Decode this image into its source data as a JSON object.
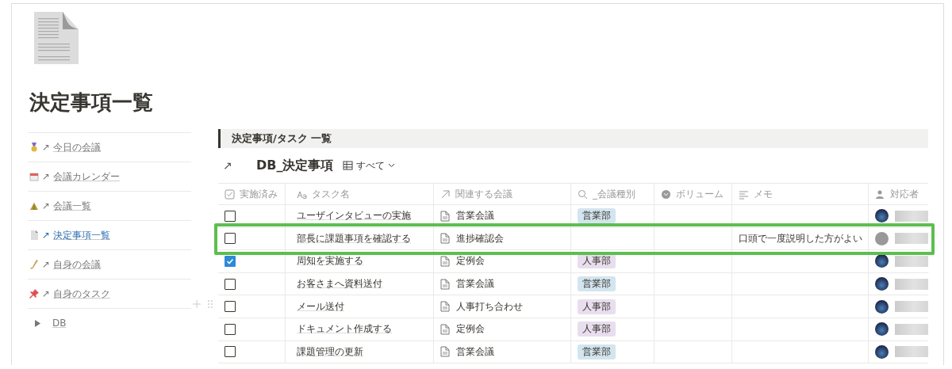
{
  "page": {
    "title": "決定事項一覧"
  },
  "sidebar": {
    "items": [
      {
        "label": "今日の会議",
        "arrow": "↗",
        "selected": false
      },
      {
        "label": "会議カレンダー",
        "arrow": "↗",
        "selected": false
      },
      {
        "label": "会議一覧",
        "arrow": "↗",
        "selected": false
      },
      {
        "label": "決定事項一覧",
        "arrow": "↗",
        "selected": true
      },
      {
        "label": "自身の会議",
        "arrow": "↗",
        "selected": false
      },
      {
        "label": "自身のタスク",
        "arrow": "↗",
        "selected": false
      }
    ],
    "toggle": {
      "label": "DB",
      "expanded": false
    }
  },
  "section": {
    "title": "決定事項/タスク 一覧"
  },
  "database": {
    "link_arrow": "↗",
    "title": "DB_決定事項",
    "view": "すべて"
  },
  "table": {
    "columns": [
      "実施済み",
      "タスク名",
      "関連する会議",
      "_会議種別",
      "ボリューム",
      "メモ",
      "対応者"
    ],
    "rows": [
      {
        "checked": false,
        "task": "ユーザインタビューの実施",
        "meeting": "営業会議",
        "tag": {
          "label": "営業部",
          "color": "#d3e5ef"
        },
        "assignee_photo": true,
        "highlighted": false
      },
      {
        "checked": false,
        "task": "部長に課題事項を確認する",
        "meeting": "進捗確認会",
        "memo": "口頭で一度説明した方がよい",
        "assignee_photo": false,
        "highlighted": true
      },
      {
        "checked": true,
        "task": "周知を実施する",
        "meeting": "定例会",
        "tag": {
          "label": "人事部",
          "color": "#e8deee"
        },
        "assignee_photo": true,
        "highlighted": false
      },
      {
        "checked": false,
        "task": "お客さまへ資料送付",
        "meeting": "営業会議",
        "tag": {
          "label": "営業部",
          "color": "#d3e5ef"
        },
        "assignee_photo": true,
        "highlighted": false
      },
      {
        "checked": false,
        "task": "メール送付",
        "meeting": "人事打ち合わせ",
        "tag": {
          "label": "人事部",
          "color": "#e8deee"
        },
        "assignee_photo": true,
        "highlighted": false
      },
      {
        "checked": false,
        "task": "ドキュメント作成する",
        "meeting": "定例会",
        "tag": {
          "label": "人事部",
          "color": "#e8deee"
        },
        "assignee_photo": true,
        "highlighted": false
      },
      {
        "checked": false,
        "task": "課題管理の更新",
        "meeting": "営業会議",
        "tag": {
          "label": "営業部",
          "color": "#d3e5ef"
        },
        "assignee_photo": true,
        "highlighted": false
      }
    ]
  }
}
